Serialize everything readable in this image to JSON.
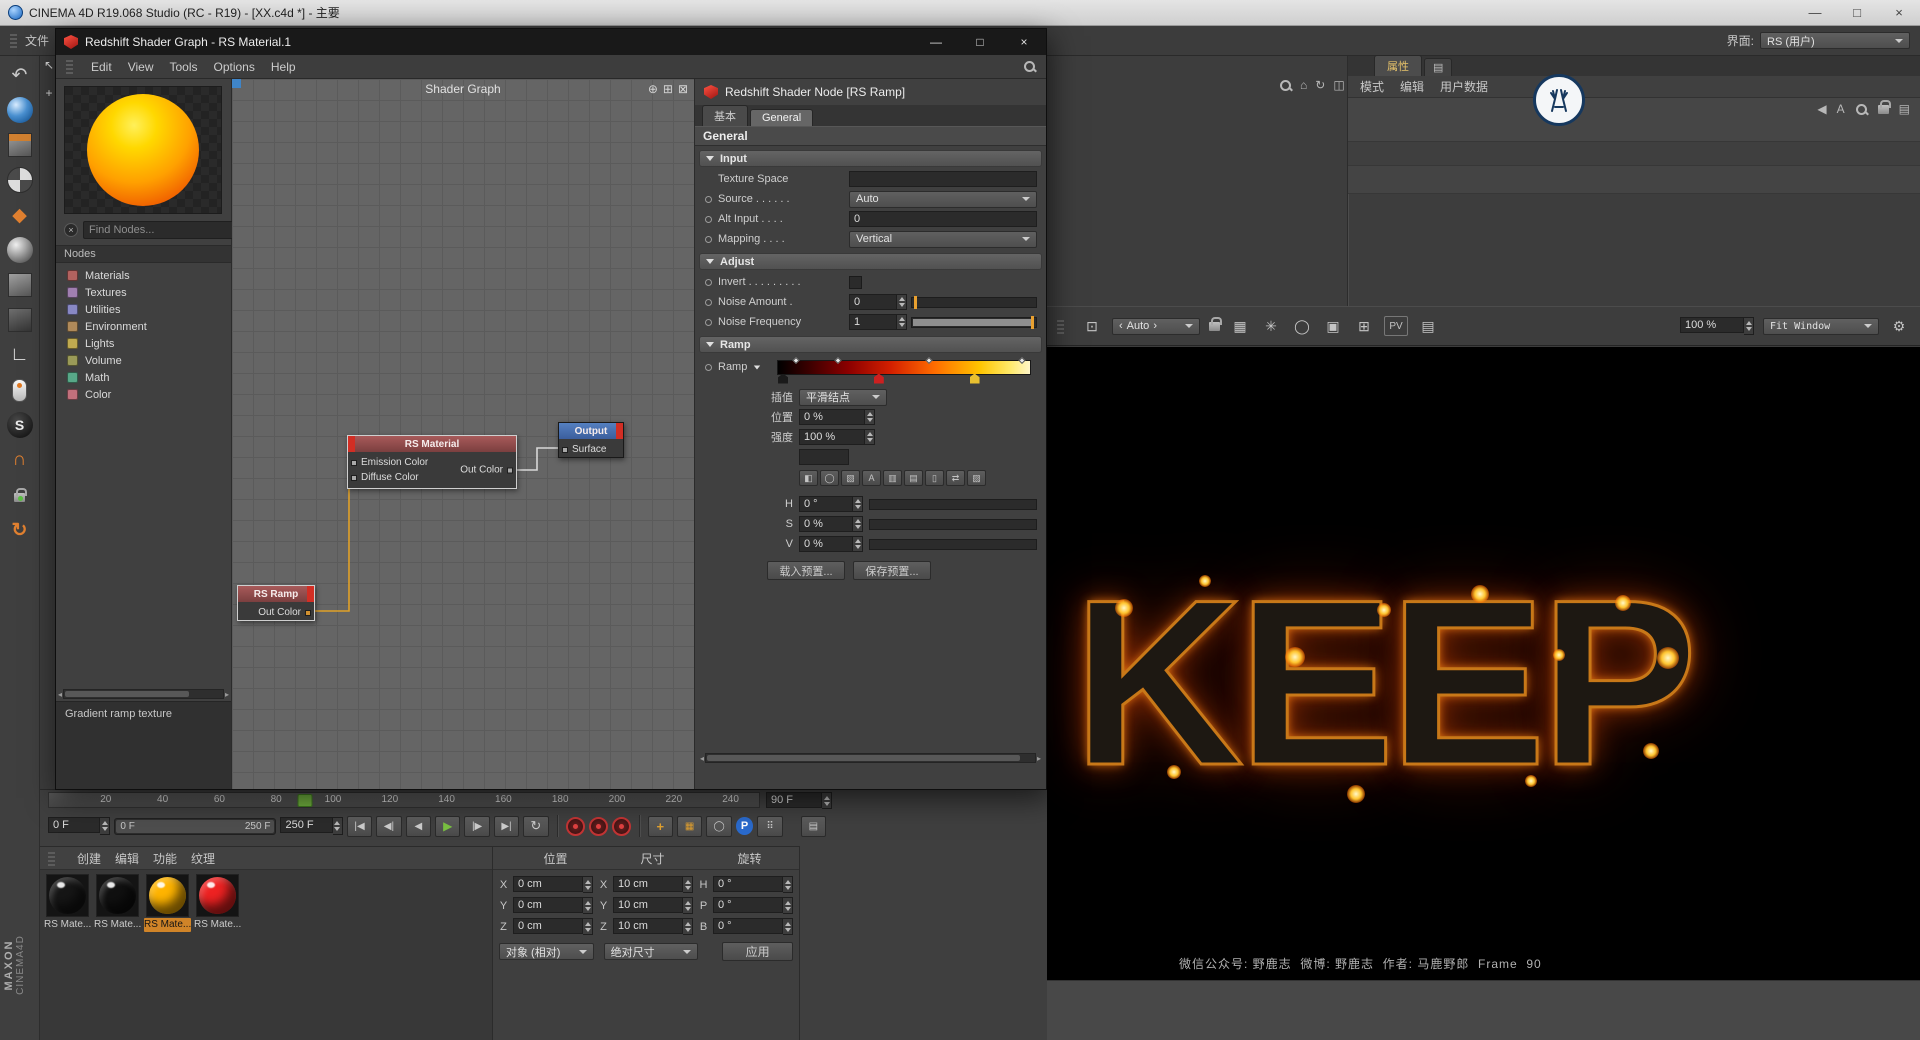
{
  "app": {
    "title": "CINEMA 4D R19.068 Studio (RC - R19) - [XX.c4d *] - 主要",
    "file_menu": "文件",
    "interface_label": "界面:",
    "interface_value": "RS (用户)"
  },
  "controls": {
    "min": "—",
    "max": "□",
    "close": "×"
  },
  "left_toolbar": {
    "undo": "↶",
    "diamond": "◆",
    "ruler": "∟",
    "redshift_s": "S",
    "magnet": "∩",
    "rotate": "↻",
    "cursor": "↖",
    "pin": "+"
  },
  "shader_window": {
    "title": "Redshift Shader Graph - RS Material.1",
    "menus": [
      "Edit",
      "View",
      "Tools",
      "Options",
      "Help"
    ],
    "left": {
      "find_placeholder": "Find Nodes...",
      "nodes_label": "Nodes",
      "clear_glyph": "×",
      "categories": [
        {
          "label": "Materials",
          "color": "#b2625f"
        },
        {
          "label": "Textures",
          "color": "#a07fb0"
        },
        {
          "label": "Utilities",
          "color": "#8888c4"
        },
        {
          "label": "Environment",
          "color": "#b08a5a"
        },
        {
          "label": "Lights",
          "color": "#c0aa50"
        },
        {
          "label": "Volume",
          "color": "#9a9a58"
        },
        {
          "label": "Math",
          "color": "#58a888"
        },
        {
          "label": "Color",
          "color": "#c2707c"
        }
      ],
      "description": "Gradient ramp texture"
    },
    "canvas": {
      "title": "Shader Graph",
      "tools": [
        "⊕",
        "⊞",
        "⊠"
      ],
      "material_node": {
        "title": "RS Material",
        "in1": "Emission Color",
        "in2": "Diffuse Color",
        "out": "Out Color"
      },
      "output_node": {
        "title": "Output",
        "port": "Surface"
      },
      "ramp_node": {
        "title": "RS Ramp",
        "out": "Out Color"
      }
    },
    "inspector": {
      "title": "Redshift Shader Node [RS Ramp]",
      "tab_basic": "基本",
      "tab_general": "General",
      "section_general": "General",
      "group_input": "Input",
      "group_adjust": "Adjust",
      "group_ramp": "Ramp",
      "texture_space_label": "Texture Space",
      "source_label": "Source . . . . . .",
      "source_value": "Auto",
      "alt_input_label": "Alt Input . . . .",
      "alt_input_value": "0",
      "mapping_label": "Mapping . . . .",
      "mapping_value": "Vertical",
      "invert_label": "Invert . . . . . . . . .",
      "noise_amount_label": "Noise Amount .",
      "noise_amount_value": "0",
      "noise_frequency_label": "Noise Frequency",
      "noise_frequency_value": "1",
      "ramp_label": "Ramp",
      "ramp_stops": [
        "#000000 0%",
        "#3a0000 12%",
        "#8c0000 28%",
        "#d42000 45%",
        "#ff6c00 62%",
        "#ffc400 80%",
        "#ffe969 92%",
        "#fff6c8 100%"
      ],
      "knots": [
        {
          "color": "#1a1a1a"
        },
        {
          "color": "#cc2020"
        },
        {
          "color": "#e8c030"
        }
      ],
      "interp_label": "插值",
      "interp_value": "平滑结点",
      "position_label": "位置",
      "position_value": "0 %",
      "strength_label": "强度",
      "strength_value": "100 %",
      "ramp_tools": [
        "◧",
        "◯",
        "▧",
        "A",
        "▥",
        "▤",
        "▯",
        "⇄",
        "▨"
      ],
      "h_label": "H",
      "h_value": "0 °",
      "s_label": "S",
      "s_value": "0 %",
      "v_label": "V",
      "v_value": "0 %",
      "load_preset": "载入预置...",
      "save_preset": "保存预置..."
    }
  },
  "attribute_panel": {
    "tab": "属性",
    "menus": [
      "模式",
      "编辑",
      "用户数据"
    ],
    "glyphs": {
      "home": "⌂",
      "refresh": "↻",
      "panel": "◫",
      "collapse": "◀",
      "letter": "A",
      "list": "▤"
    }
  },
  "picture_viewer": {
    "auto_value": "Auto",
    "zoom_value": "100 %",
    "fit_value": "Fit Window",
    "image_text": "KEEP",
    "caption": "微信公众号: 野鹿志  微博: 野鹿志  作者: 马鹿野郎  Frame  90",
    "glyphs": {
      "crop": "⊡",
      "grid": "▦",
      "star": "✳",
      "circle": "◯",
      "image": "▣",
      "add": "⊞",
      "pv": "PV",
      "copy": "▤",
      "gear": "⚙",
      "left": "‹",
      "right": "›"
    }
  },
  "timeline": {
    "ticks": [
      "20",
      "40",
      "60",
      "80",
      "100",
      "120",
      "140",
      "160",
      "180",
      "200",
      "220",
      "240"
    ],
    "current_frame": "90 F",
    "start_frame": "0 F",
    "range_start": "0 F",
    "range_end": "250 F",
    "end_frame": "250 F",
    "transport": [
      {
        "name": "go-to-start-button",
        "glyph": "|◀"
      },
      {
        "name": "previous-key-button",
        "glyph": "◀|"
      },
      {
        "name": "previous-frame-button",
        "glyph": "◀"
      },
      {
        "name": "play-button",
        "glyph": "▶"
      },
      {
        "name": "next-key-button",
        "glyph": "|▶"
      },
      {
        "name": "go-to-end-button",
        "glyph": "▶|"
      },
      {
        "name": "loop-button",
        "glyph": "↻"
      }
    ],
    "modes": [
      {
        "name": "move-mode-button",
        "glyph": "+"
      },
      {
        "name": "snap-grid-button",
        "glyph": "▦"
      },
      {
        "name": "circle-mode-button",
        "glyph": "◯"
      },
      {
        "name": "parameter-mode-button",
        "glyph": "P"
      },
      {
        "name": "dots-grid-button",
        "glyph": "⠿"
      },
      {
        "name": "layer-list-button",
        "glyph": "▤"
      }
    ]
  },
  "materials_panel": {
    "menus": [
      "创建",
      "编辑",
      "功能",
      "纹理"
    ],
    "items": [
      {
        "label": "RS Mate...",
        "color": "#161616"
      },
      {
        "label": "RS Mate...",
        "color": "#101010"
      },
      {
        "label": "RS Mate...",
        "color": "#ffb400"
      },
      {
        "label": "RS Mate...",
        "color": "#ee2222"
      }
    ]
  },
  "coordinates_panel": {
    "headers": [
      "位置",
      "尺寸",
      "旋转"
    ],
    "pos_rows": [
      {
        "l": "X",
        "v": "0 cm"
      },
      {
        "l": "Y",
        "v": "0 cm"
      },
      {
        "l": "Z",
        "v": "0 cm"
      }
    ],
    "size_rows": [
      {
        "l": "X",
        "v": "10 cm"
      },
      {
        "l": "Y",
        "v": "10 cm"
      },
      {
        "l": "Z",
        "v": "10 cm"
      }
    ],
    "rot_rows": [
      {
        "l": "H",
        "v": "0 °"
      },
      {
        "l": "P",
        "v": "0 °"
      },
      {
        "l": "B",
        "v": "0 °"
      }
    ],
    "mode_object": "对象 (相对)",
    "mode_size": "绝对尺寸",
    "apply": "应用"
  },
  "branding": {
    "maxon": "MAXON",
    "c4d": "CINEMA4D"
  }
}
